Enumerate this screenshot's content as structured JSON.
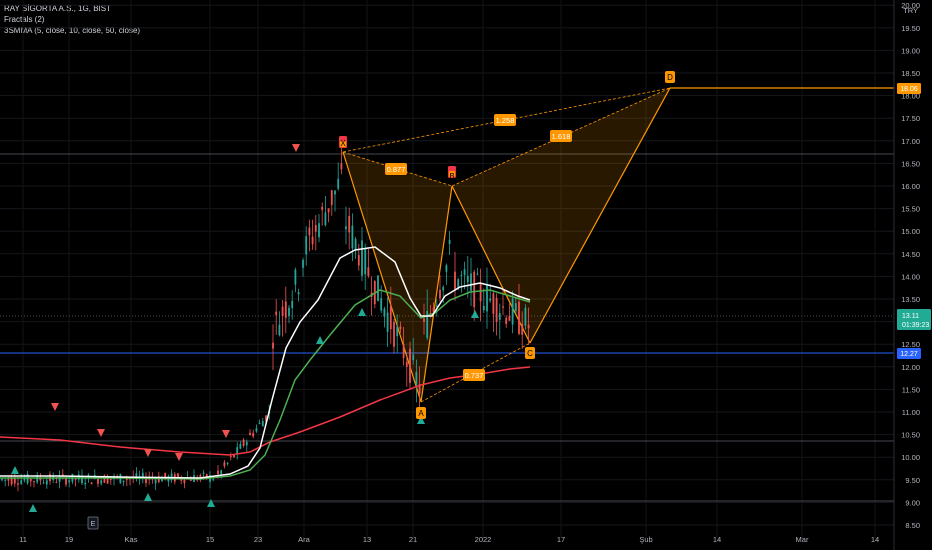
{
  "legend": {
    "symbol": "RAY SİGORTA A.Ş., 1G, BIST",
    "fractals": "Fractals (2)",
    "smma": "3SMMA (5, close, 10, close, 50, close)"
  },
  "chart_data": {
    "type": "candlestick",
    "currency": "TRY",
    "ylim": [
      8.5,
      20.0
    ],
    "y_ticks": [
      "8.50",
      "9.00",
      "9.50",
      "10.00",
      "10.50",
      "11.00",
      "11.50",
      "12.00",
      "12.50",
      "13.00",
      "13.50",
      "14.00",
      "14.50",
      "15.00",
      "15.50",
      "16.00",
      "16.50",
      "17.00",
      "17.50",
      "18.00",
      "18.50",
      "19.00",
      "19.50",
      "20.00"
    ],
    "x_ticks": [
      "11",
      "19",
      "Kas",
      "15",
      "23",
      "Ara",
      "13",
      "21",
      "2022",
      "17",
      "Şub",
      "14",
      "Mar",
      "14"
    ],
    "colors": {
      "up": "#26a69a",
      "down": "#ef5350",
      "smma5": "#ffffff",
      "smma10": "#4caf50",
      "smma50": "#f23645",
      "pattern": "#ff9800",
      "blue_line": "#2962ff",
      "accent": "#22ab94"
    },
    "price_badges": {
      "last": "13.11",
      "countdown": "01:39:23",
      "target": "18.06",
      "blue_level": "12.27"
    },
    "harmonic_pattern": {
      "points": [
        {
          "label": "X",
          "value": 16.7
        },
        {
          "label": "A",
          "value": 11.15
        },
        {
          "label": "B",
          "value": 16.0
        },
        {
          "label": "C",
          "value": 12.45
        },
        {
          "label": "D",
          "value": 18.06
        }
      ],
      "ratios": [
        "0.877",
        "1.258",
        "1.618",
        "0.737"
      ]
    },
    "fractal_marks": {
      "down_count": 6,
      "up_count": 8
    },
    "event_marker": "E",
    "series": [
      {
        "name": "3SMMA 5"
      },
      {
        "name": "3SMMA 10"
      },
      {
        "name": "3SMMA 50"
      }
    ]
  }
}
